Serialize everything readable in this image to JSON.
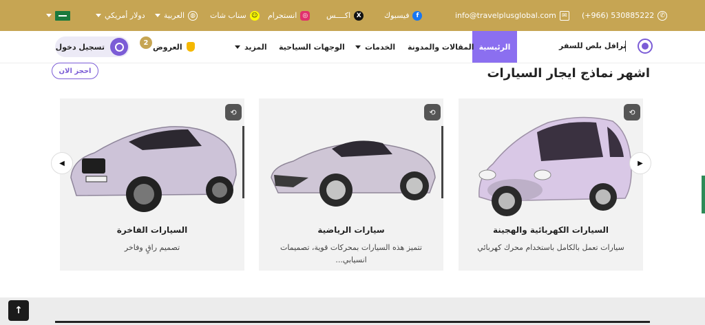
{
  "topbar": {
    "phone": "(+966) 530885222",
    "email": "info@travelplusglobal.com",
    "facebook": "فيسبوك",
    "x": "اكــــس",
    "instagram": "انستجرام",
    "snapchat": "سناب شات",
    "language": "العربية",
    "currency": "دولار أمريكي"
  },
  "nav": {
    "brand": "ترافل بلص للسفر",
    "home": "الرئيسية",
    "blog": "المقالات والمدونة",
    "services": "الخدمات",
    "destinations": "الوجهات السياحية",
    "more": "المزيد",
    "offers": "العروض",
    "offers_count": "2",
    "login": "تسجيل دخول"
  },
  "section": {
    "title": "اشهر نماذج ايجار السيارات",
    "book_button": "احجز الان"
  },
  "cards": [
    {
      "name": "السيارات الكهربائية والهجينة",
      "description": "سيارات تعمل بالكامل باستخدام محرك كهربائي",
      "car_color": "#d8c6e6"
    },
    {
      "name": "سيارات الرياضية",
      "description": "تتميز هذه السيارات بمحركات قوية، تصميمات انسيابي...",
      "car_color": "#cfc6d6"
    },
    {
      "name": "السيارات الفاخرة",
      "description": "تصميم راقٍ وفاخر",
      "car_color": "#cdc3d8"
    }
  ],
  "colors": {
    "topbar": "#c6a553",
    "accent": "#8b6ff0",
    "card_bg": "#f2f2f2"
  }
}
